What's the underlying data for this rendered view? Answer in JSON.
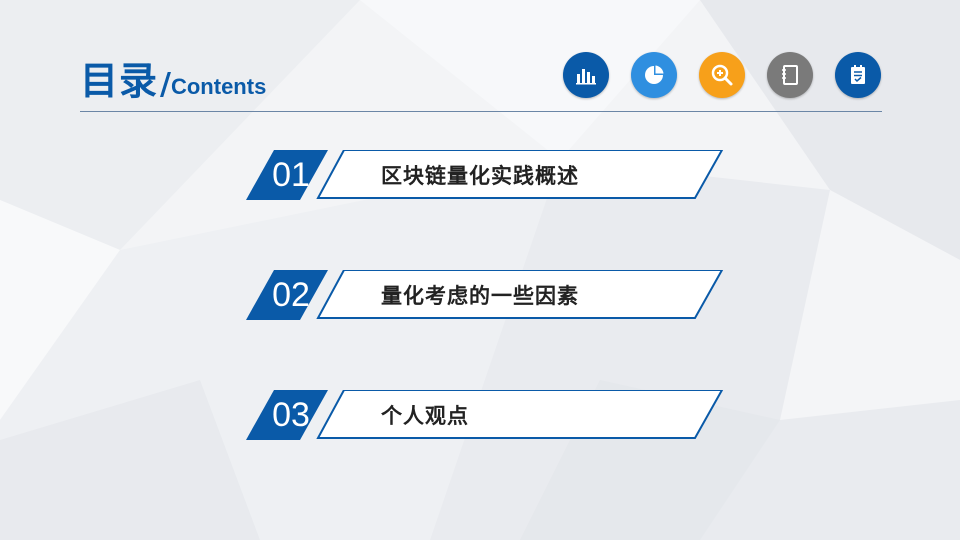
{
  "slide": {
    "title_main": "目录",
    "title_slash": "/",
    "title_sub": "Contents"
  },
  "icons": [
    {
      "name": "bar-chart-icon",
      "color": "#0a5aa8"
    },
    {
      "name": "pie-chart-icon",
      "color": "#2f8fe0"
    },
    {
      "name": "magnify-plus-icon",
      "color": "#f7a01a"
    },
    {
      "name": "notebook-icon",
      "color": "#7a7a7a"
    },
    {
      "name": "checklist-icon",
      "color": "#0a5aa8"
    }
  ],
  "toc": [
    {
      "num": "01",
      "label": "区块链量化实践概述"
    },
    {
      "num": "02",
      "label": "量化考虑的一些因素"
    },
    {
      "num": "03",
      "label": "个人观点"
    }
  ],
  "colors": {
    "accent": "#0a5aa8",
    "text": "#222222"
  }
}
